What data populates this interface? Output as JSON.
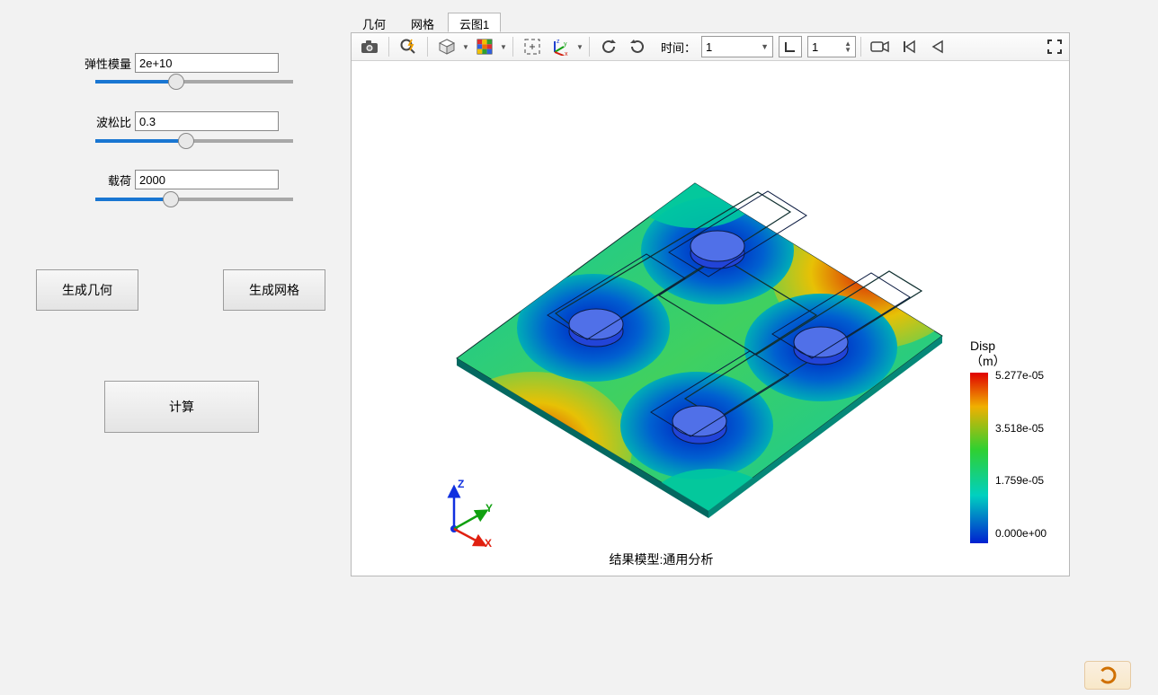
{
  "tabs": [
    {
      "label": "几何",
      "active": false
    },
    {
      "label": "网格",
      "active": false
    },
    {
      "label": "云图1",
      "active": true
    }
  ],
  "sidebar": {
    "params": [
      {
        "label": "弹性模量",
        "value": "2e+10",
        "slider_fill_pct": 41
      },
      {
        "label": "波松比",
        "value": "0.3",
        "slider_fill_pct": 46
      },
      {
        "label": "载荷",
        "value": "2000",
        "slider_fill_pct": 38
      }
    ],
    "buttons": {
      "gen_geom": "生成几何",
      "gen_mesh": "生成网格",
      "compute": "计算"
    }
  },
  "toolbar": {
    "time_label": "时间：",
    "time_value": "1",
    "spin_value": "1"
  },
  "canvas": {
    "caption": "结果模型:通用分析",
    "axes": {
      "x": "X",
      "y": "Y",
      "z": "Z"
    }
  },
  "legend": {
    "title_line1": "Disp",
    "title_line2": "（m）",
    "ticks": [
      "5.277e-05",
      "3.518e-05",
      "1.759e-05",
      "0.000e+00"
    ]
  },
  "chart_data": {
    "type": "heatmap",
    "title": "结果模型:通用分析",
    "result_name": "Disp",
    "units": "m",
    "time": 1,
    "colormap": "rainbow",
    "range": [
      0.0,
      5.277e-05
    ],
    "ticks": [
      0.0,
      1.759e-05,
      3.518e-05,
      5.277e-05
    ],
    "inputs": {
      "elastic_modulus": 20000000000.0,
      "poisson_ratio": 0.3,
      "load": 2000
    },
    "note": "3D contour plot of displacement magnitude on a square plate with an H-shaped cutout and four cylindrical bosses; highest displacement near left and right mid-edges, near-zero at the four bosses."
  }
}
